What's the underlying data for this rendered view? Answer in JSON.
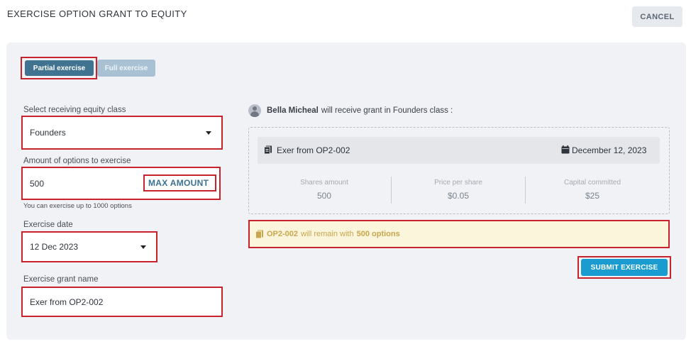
{
  "header": {
    "title": "EXERCISE OPTION GRANT TO EQUITY",
    "cancel_label": "CANCEL"
  },
  "mode_toggle": {
    "partial_label": "Partial exercise",
    "full_label": "Full exercise",
    "selected": "Partial exercise"
  },
  "form": {
    "equity_class": {
      "label": "Select receiving equity class",
      "value": "Founders"
    },
    "amount": {
      "label": "Amount of options to exercise",
      "value": "500",
      "max_label": "MAX AMOUNT",
      "hint": "You can exercise up to 1000 options"
    },
    "exercise_date": {
      "label": "Exercise date",
      "value": "12 Dec 2023"
    },
    "grant_name": {
      "label": "Exercise grant name",
      "value": "Exer from OP2-002"
    }
  },
  "summary": {
    "recipient_name": "Bella Micheal",
    "receive_text": "will receive grant in Founders class :",
    "grant_name": "Exer from OP2-002",
    "grant_date": "December 12, 2023",
    "stats": [
      {
        "label": "Shares amount",
        "value": "500"
      },
      {
        "label": "Price per share",
        "value": "$0.05"
      },
      {
        "label": "Capital committed",
        "value": "$25"
      }
    ],
    "remaining": {
      "grant": "OP2-002",
      "mid": "will remain with",
      "count": "500 options"
    }
  },
  "submit_label": "SUBMIT EXERCISE",
  "colors": {
    "accent": "#3f7390",
    "submit": "#1a9cd0",
    "highlight_border": "#c8232c",
    "warning_bg": "#fbf5dc",
    "warning_text": "#c8a64b"
  }
}
